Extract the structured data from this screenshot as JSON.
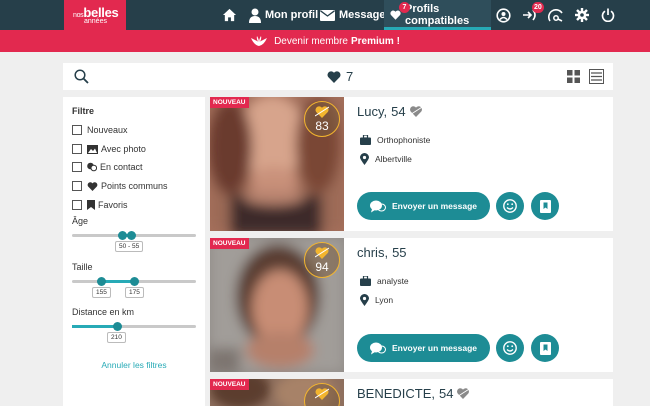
{
  "logo": {
    "line1": "nos",
    "line2": "belles",
    "line3": "années"
  },
  "nav": {
    "profile_label": "Mon profil",
    "messages_label": "Messages",
    "compatible_label": "Profils compatibles",
    "compatible_badge": "7",
    "visits_badge": "20"
  },
  "premium": {
    "text": "Devenir membre",
    "strong": "Premium !"
  },
  "toolbar": {
    "likes_count": "7"
  },
  "filters": {
    "title": "Filtre",
    "checkboxes": [
      "Nouveaux",
      "Avec photo",
      "En contact",
      "Points communs",
      "Favoris"
    ],
    "age": {
      "label": "Âge",
      "value": "50 - 55"
    },
    "height": {
      "label": "Taille",
      "min": "155",
      "max": "175"
    },
    "distance": {
      "label": "Distance en km",
      "value": "210"
    },
    "cancel": "Annuler les filtres"
  },
  "profiles": [
    {
      "name": "Lucy,",
      "age": "54",
      "badge": "NOUVEAU",
      "score": "83",
      "job": "Orthophoniste",
      "city": "Albertville",
      "message_label": "Envoyer un message"
    },
    {
      "name": "chris,",
      "age": "55",
      "badge": "NOUVEAU",
      "score": "94",
      "job": "analyste",
      "city": "Lyon",
      "message_label": "Envoyer un message"
    },
    {
      "name": "BENEDICTE,",
      "age": "54",
      "badge": "NOUVEAU",
      "score": "",
      "job": "",
      "city": "",
      "message_label": ""
    }
  ],
  "colors": {
    "nav_bg": "#263f4a",
    "brand_red": "#e2294f",
    "teal": "#1d8c95",
    "accent": "#27aab6",
    "gold": "#f3b52e"
  },
  "icons": [
    "home-icon",
    "user-icon",
    "envelope-icon",
    "heart-icon",
    "profile-search-icon",
    "visits-icon",
    "radar-icon",
    "gear-icon",
    "power-icon",
    "search-icon",
    "grid-view-icon",
    "list-view-icon",
    "briefcase-icon",
    "location-pin-icon",
    "smile-icon",
    "bookmark-icon"
  ]
}
